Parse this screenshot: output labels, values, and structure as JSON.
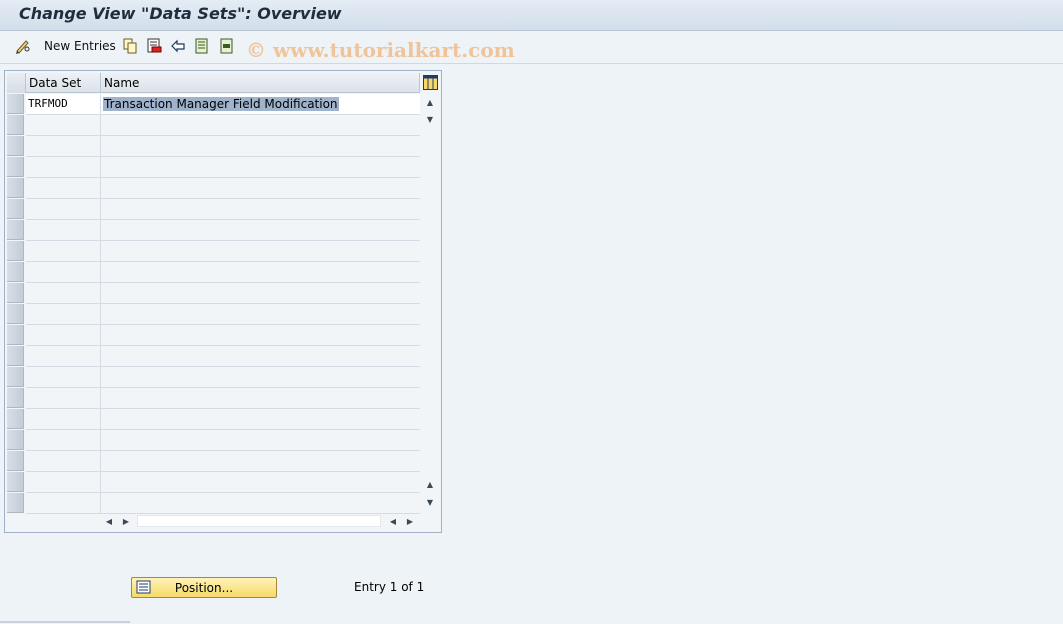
{
  "window": {
    "title": "Change View \"Data Sets\": Overview"
  },
  "toolbar": {
    "new_entries_label": "New Entries"
  },
  "watermark": "© www.tutorialkart.com",
  "table": {
    "columns": [
      "Data Set",
      "Name"
    ],
    "rows": [
      {
        "data_set": "TRFMOD",
        "name": "Transaction Manager Field Modification"
      }
    ]
  },
  "footer": {
    "position_label": "Position...",
    "entry_info": "Entry 1 of 1"
  },
  "colors": {
    "title_bar": "#d3deea",
    "background": "#eef3f8",
    "selection": "#9fb4cc",
    "button": "#f7d96a"
  }
}
